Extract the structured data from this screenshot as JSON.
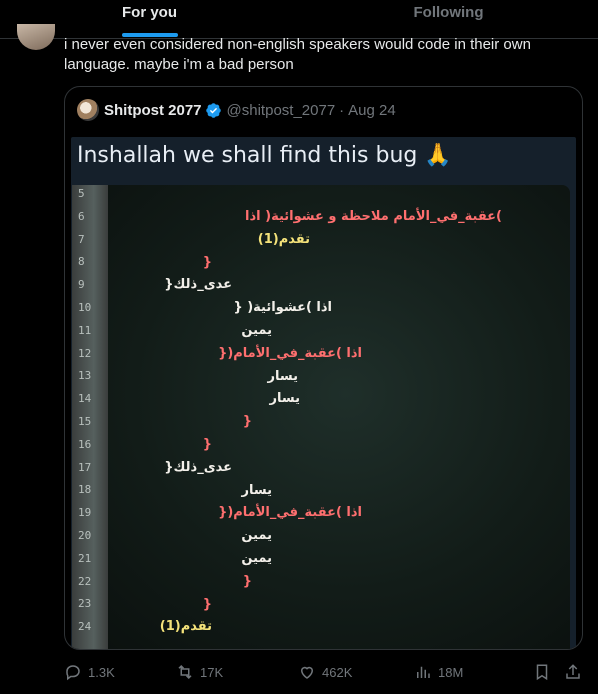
{
  "tabs": [
    {
      "label": "For you",
      "active": true
    },
    {
      "label": "Following",
      "active": false
    }
  ],
  "tweet": {
    "text": "i never even considered non-english speakers would code in their own language. maybe i'm a bad person"
  },
  "quote": {
    "name": "Shitpost 2077",
    "handle": "@shitpost_2077",
    "sep": "·",
    "date": "Aug 24",
    "media": {
      "caption": "Inshallah we shall find this bug",
      "caption_emoji": "🙏",
      "line_numbers": [
        "5",
        "6",
        "7",
        "8",
        "9",
        "10",
        "11",
        "12",
        "13",
        "14",
        "15",
        "16",
        "17",
        "18",
        "19",
        "20",
        "21",
        "22",
        "23",
        "24"
      ],
      "code_lines": [
        {
          "text": ")عقبة_في_الأمام    ملاحظة و عشوائية( اذا",
          "color": "red"
        },
        {
          "text": "تقدم(1)",
          "color": "yellow"
        },
        {
          "text": "}",
          "color": "red"
        },
        {
          "text": "عدى_ذلك{",
          "color": "white"
        },
        {
          "text": "اذا )عشوائية( {",
          "color": "white"
        },
        {
          "text": "يمين",
          "color": "white"
        },
        {
          "text": "اذا )عقبة_في_الأمام({",
          "color": "red"
        },
        {
          "text": "يسار",
          "color": "white"
        },
        {
          "text": "يسار",
          "color": "white"
        },
        {
          "text": "}",
          "color": "red"
        },
        {
          "text": "}",
          "color": "red"
        },
        {
          "text": "عدى_ذلك{",
          "color": "white"
        },
        {
          "text": "يسار",
          "color": "white"
        },
        {
          "text": "اذا )عقبة_في_الأمام({",
          "color": "red"
        },
        {
          "text": "يمين",
          "color": "white"
        },
        {
          "text": "يمين",
          "color": "white"
        },
        {
          "text": "}",
          "color": "red"
        },
        {
          "text": "}",
          "color": "red"
        },
        {
          "text": "تقدم(1)",
          "color": "yellow"
        }
      ]
    }
  },
  "actions": {
    "replies": "1.3K",
    "reposts": "17K",
    "likes": "462K",
    "views": "18M"
  },
  "colors": {
    "accent": "#1d9bf0",
    "muted": "#71767b",
    "text": "#e7e9ea",
    "border": "#2f3336"
  }
}
